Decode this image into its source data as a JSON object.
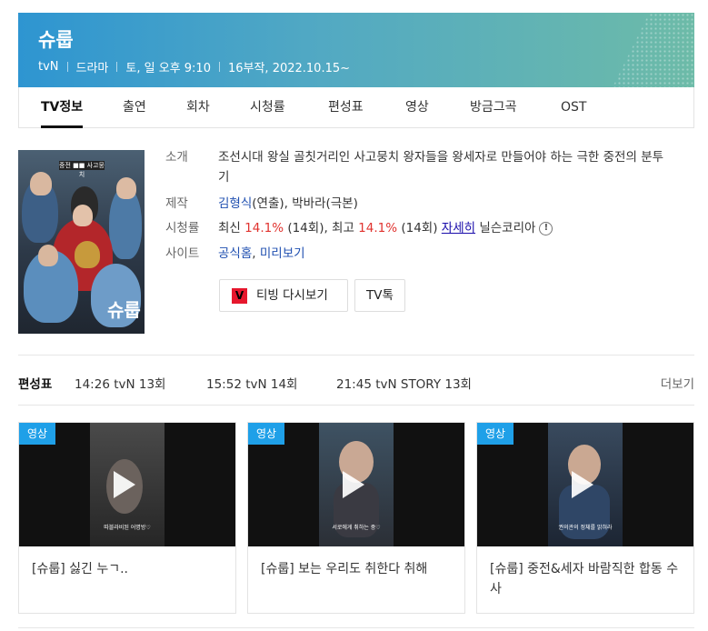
{
  "header": {
    "title": "슈룹",
    "meta": [
      "tvN",
      "드라마",
      "토, 일 오후 9:10",
      "16부작, 2022.10.15~"
    ]
  },
  "tabs": [
    {
      "label": "TV정보",
      "active": true
    },
    {
      "label": "출연"
    },
    {
      "label": "회차"
    },
    {
      "label": "시청률"
    },
    {
      "label": "편성표"
    },
    {
      "label": "영상"
    },
    {
      "label": "방금그곡"
    },
    {
      "label": "OST"
    }
  ],
  "poster": {
    "logo": "슈룹"
  },
  "info": {
    "intro_label": "소개",
    "intro_text": "조선시대 왕실 골칫거리인 사고뭉치 왕자들을 왕세자로 만들어야 하는 극한 중전의 분투기",
    "production_label": "제작",
    "director": "김형식",
    "director_role": "(연출), ",
    "writer": "박바라",
    "writer_role": "(극본)",
    "rating_label": "시청률",
    "latest_prefix": "최신 ",
    "latest_value": "14.1%",
    "latest_ep": " (14회), 최고 ",
    "best_value": "14.1%",
    "best_ep": " (14회) ",
    "detail_link": "자세히",
    "source": " 닐슨코리아",
    "site_label": "사이트",
    "site_official": "공식홈",
    "site_sep": ", ",
    "site_preview": "미리보기"
  },
  "buttons": {
    "tving_icon": "V",
    "tving": "티빙 다시보기",
    "tvtalk": "TV톡"
  },
  "schedule": {
    "label": "편성표",
    "items": [
      "14:26 tvN 13회",
      "15:52 tvN 14회",
      "21:45 tvN STORY 13회"
    ],
    "more": "더보기"
  },
  "videos": [
    {
      "badge": "영상",
      "title": "[슈룹] 싫긴 누ㄱ..",
      "caption": "따블라비된 어명방♡"
    },
    {
      "badge": "영상",
      "title": "[슈룹] 보는 우리도 취한다 취해",
      "caption": "서로에게 취하는 중♡"
    },
    {
      "badge": "영상",
      "title": "[슈룹] 중전&세자 바람직한 합동 수사",
      "caption": "권의관의 정체를 밝혀라"
    }
  ],
  "colors": {
    "accent": "#1fa0e8",
    "rating": "#e0332f",
    "link": "#1a0dab",
    "tving": "#e6172d"
  }
}
